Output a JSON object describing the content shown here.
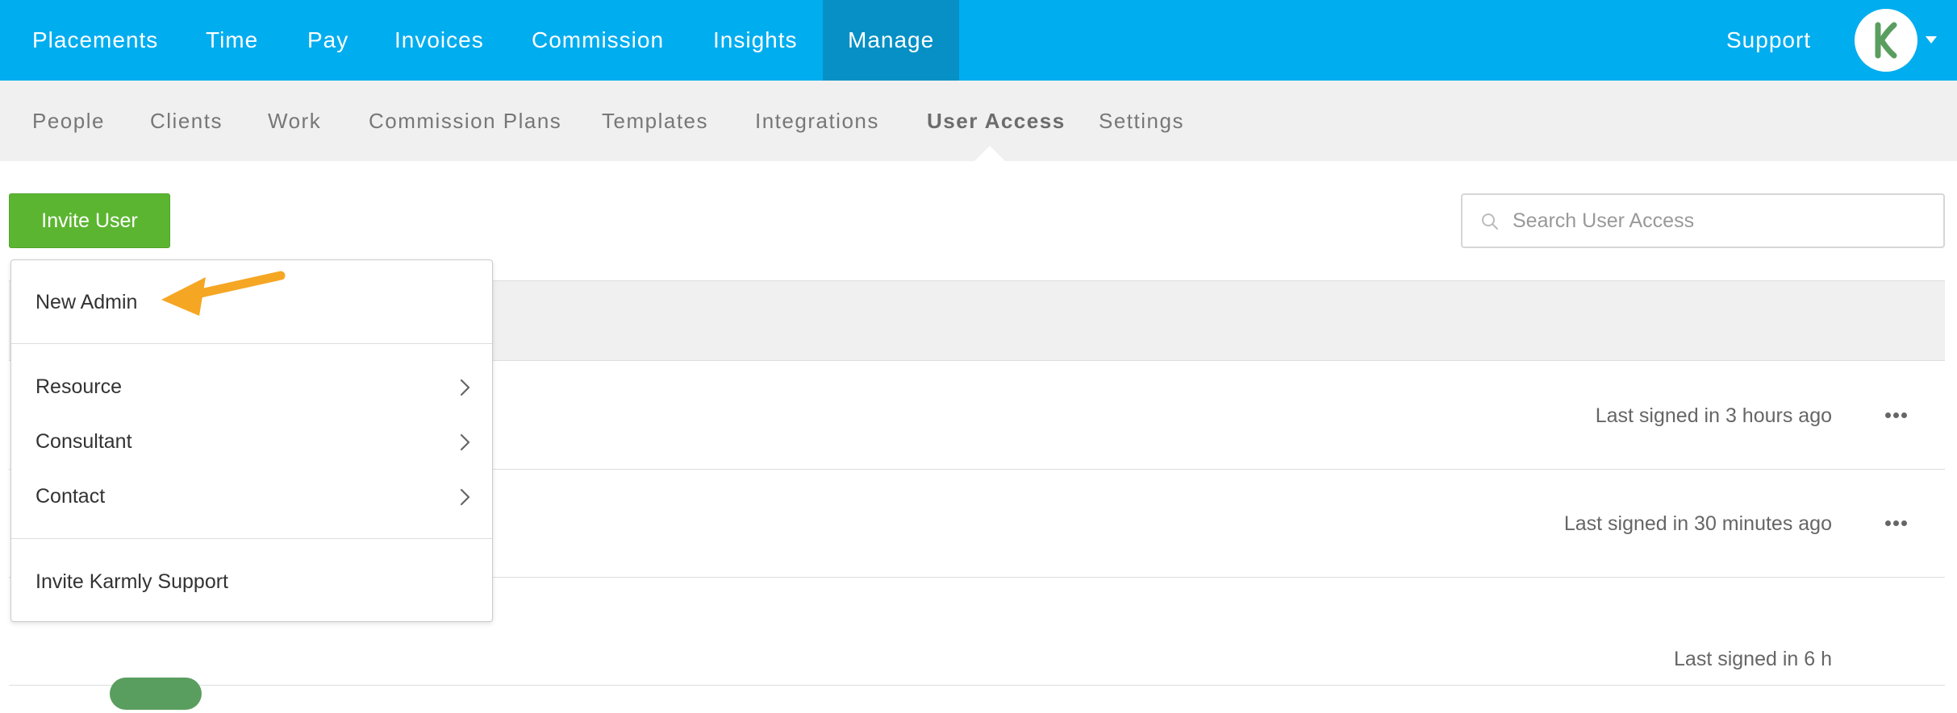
{
  "top_nav": {
    "items": [
      {
        "label": "Placements"
      },
      {
        "label": "Time"
      },
      {
        "label": "Pay"
      },
      {
        "label": "Invoices"
      },
      {
        "label": "Commission"
      },
      {
        "label": "Insights"
      },
      {
        "label": "Manage",
        "active": true
      }
    ],
    "support_label": "Support",
    "avatar_icon": "karmly-logo-icon",
    "accent_color": "#00adef"
  },
  "sub_nav": {
    "items": [
      {
        "label": "People"
      },
      {
        "label": "Clients"
      },
      {
        "label": "Work"
      },
      {
        "label": "Commission Plans"
      },
      {
        "label": "Templates"
      },
      {
        "label": "Integrations"
      },
      {
        "label": "User Access",
        "active": true
      },
      {
        "label": "Settings"
      }
    ]
  },
  "toolbar": {
    "invite_label": "Invite User",
    "invite_color": "#5cb531",
    "search_placeholder": "Search User Access"
  },
  "invite_menu": {
    "items": [
      {
        "label": "New Admin",
        "has_submenu": false
      },
      {
        "label": "Resource",
        "has_submenu": true
      },
      {
        "label": "Consultant",
        "has_submenu": true
      },
      {
        "label": "Contact",
        "has_submenu": true
      },
      {
        "label": "Invite Karmly Support",
        "has_submenu": false
      }
    ]
  },
  "users": {
    "rows": [
      {
        "last_signed": "Last signed in 3 hours ago"
      },
      {
        "last_signed": "Last signed in 30 minutes ago"
      },
      {
        "last_signed": "Last signed in 6 h"
      }
    ]
  },
  "annotation": {
    "arrow_color": "#f5a623"
  }
}
